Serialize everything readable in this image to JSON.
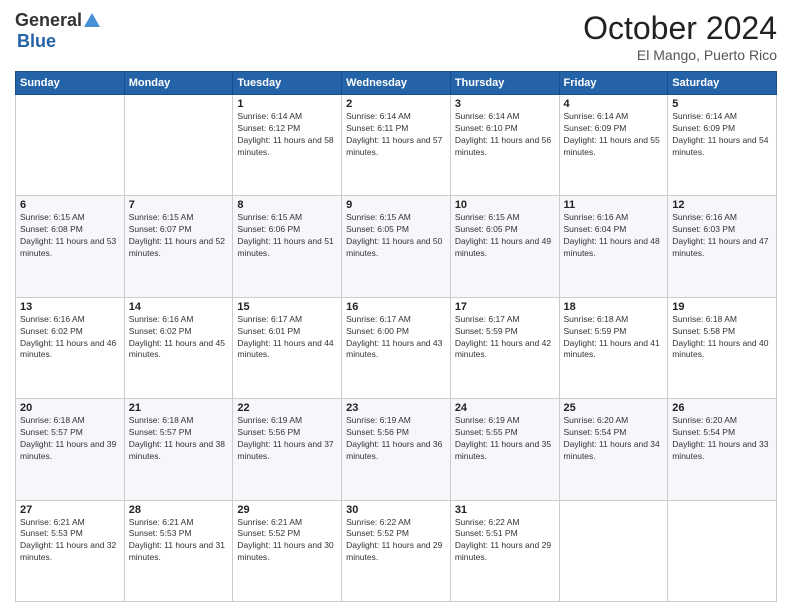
{
  "logo": {
    "general": "General",
    "blue": "Blue"
  },
  "header": {
    "month": "October 2024",
    "location": "El Mango, Puerto Rico"
  },
  "weekdays": [
    "Sunday",
    "Monday",
    "Tuesday",
    "Wednesday",
    "Thursday",
    "Friday",
    "Saturday"
  ],
  "weeks": [
    [
      {
        "day": "",
        "info": ""
      },
      {
        "day": "",
        "info": ""
      },
      {
        "day": "1",
        "info": "Sunrise: 6:14 AM\nSunset: 6:12 PM\nDaylight: 11 hours and 58 minutes."
      },
      {
        "day": "2",
        "info": "Sunrise: 6:14 AM\nSunset: 6:11 PM\nDaylight: 11 hours and 57 minutes."
      },
      {
        "day": "3",
        "info": "Sunrise: 6:14 AM\nSunset: 6:10 PM\nDaylight: 11 hours and 56 minutes."
      },
      {
        "day": "4",
        "info": "Sunrise: 6:14 AM\nSunset: 6:09 PM\nDaylight: 11 hours and 55 minutes."
      },
      {
        "day": "5",
        "info": "Sunrise: 6:14 AM\nSunset: 6:09 PM\nDaylight: 11 hours and 54 minutes."
      }
    ],
    [
      {
        "day": "6",
        "info": "Sunrise: 6:15 AM\nSunset: 6:08 PM\nDaylight: 11 hours and 53 minutes."
      },
      {
        "day": "7",
        "info": "Sunrise: 6:15 AM\nSunset: 6:07 PM\nDaylight: 11 hours and 52 minutes."
      },
      {
        "day": "8",
        "info": "Sunrise: 6:15 AM\nSunset: 6:06 PM\nDaylight: 11 hours and 51 minutes."
      },
      {
        "day": "9",
        "info": "Sunrise: 6:15 AM\nSunset: 6:05 PM\nDaylight: 11 hours and 50 minutes."
      },
      {
        "day": "10",
        "info": "Sunrise: 6:15 AM\nSunset: 6:05 PM\nDaylight: 11 hours and 49 minutes."
      },
      {
        "day": "11",
        "info": "Sunrise: 6:16 AM\nSunset: 6:04 PM\nDaylight: 11 hours and 48 minutes."
      },
      {
        "day": "12",
        "info": "Sunrise: 6:16 AM\nSunset: 6:03 PM\nDaylight: 11 hours and 47 minutes."
      }
    ],
    [
      {
        "day": "13",
        "info": "Sunrise: 6:16 AM\nSunset: 6:02 PM\nDaylight: 11 hours and 46 minutes."
      },
      {
        "day": "14",
        "info": "Sunrise: 6:16 AM\nSunset: 6:02 PM\nDaylight: 11 hours and 45 minutes."
      },
      {
        "day": "15",
        "info": "Sunrise: 6:17 AM\nSunset: 6:01 PM\nDaylight: 11 hours and 44 minutes."
      },
      {
        "day": "16",
        "info": "Sunrise: 6:17 AM\nSunset: 6:00 PM\nDaylight: 11 hours and 43 minutes."
      },
      {
        "day": "17",
        "info": "Sunrise: 6:17 AM\nSunset: 5:59 PM\nDaylight: 11 hours and 42 minutes."
      },
      {
        "day": "18",
        "info": "Sunrise: 6:18 AM\nSunset: 5:59 PM\nDaylight: 11 hours and 41 minutes."
      },
      {
        "day": "19",
        "info": "Sunrise: 6:18 AM\nSunset: 5:58 PM\nDaylight: 11 hours and 40 minutes."
      }
    ],
    [
      {
        "day": "20",
        "info": "Sunrise: 6:18 AM\nSunset: 5:57 PM\nDaylight: 11 hours and 39 minutes."
      },
      {
        "day": "21",
        "info": "Sunrise: 6:18 AM\nSunset: 5:57 PM\nDaylight: 11 hours and 38 minutes."
      },
      {
        "day": "22",
        "info": "Sunrise: 6:19 AM\nSunset: 5:56 PM\nDaylight: 11 hours and 37 minutes."
      },
      {
        "day": "23",
        "info": "Sunrise: 6:19 AM\nSunset: 5:56 PM\nDaylight: 11 hours and 36 minutes."
      },
      {
        "day": "24",
        "info": "Sunrise: 6:19 AM\nSunset: 5:55 PM\nDaylight: 11 hours and 35 minutes."
      },
      {
        "day": "25",
        "info": "Sunrise: 6:20 AM\nSunset: 5:54 PM\nDaylight: 11 hours and 34 minutes."
      },
      {
        "day": "26",
        "info": "Sunrise: 6:20 AM\nSunset: 5:54 PM\nDaylight: 11 hours and 33 minutes."
      }
    ],
    [
      {
        "day": "27",
        "info": "Sunrise: 6:21 AM\nSunset: 5:53 PM\nDaylight: 11 hours and 32 minutes."
      },
      {
        "day": "28",
        "info": "Sunrise: 6:21 AM\nSunset: 5:53 PM\nDaylight: 11 hours and 31 minutes."
      },
      {
        "day": "29",
        "info": "Sunrise: 6:21 AM\nSunset: 5:52 PM\nDaylight: 11 hours and 30 minutes."
      },
      {
        "day": "30",
        "info": "Sunrise: 6:22 AM\nSunset: 5:52 PM\nDaylight: 11 hours and 29 minutes."
      },
      {
        "day": "31",
        "info": "Sunrise: 6:22 AM\nSunset: 5:51 PM\nDaylight: 11 hours and 29 minutes."
      },
      {
        "day": "",
        "info": ""
      },
      {
        "day": "",
        "info": ""
      }
    ]
  ]
}
